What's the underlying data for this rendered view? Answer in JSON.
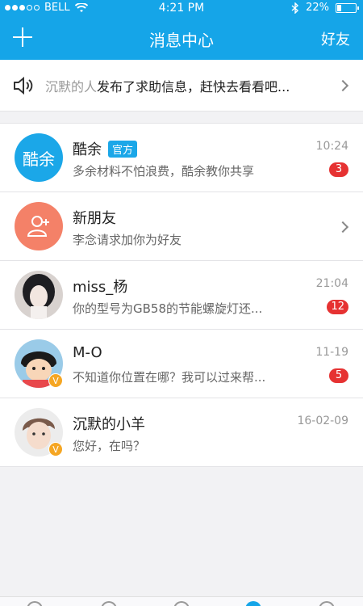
{
  "status_bar": {
    "carrier": "BELL",
    "time": "4:21 PM",
    "battery": "22%",
    "battery_level": 0.22
  },
  "nav": {
    "title": "消息中心",
    "right_label": "好友"
  },
  "notice": {
    "name": "沉默的人",
    "text": "发布了求助信息，赶快去看看吧..."
  },
  "rows": [
    {
      "title": "酷余",
      "tag": "官方",
      "avatar_text": "酷余",
      "subtitle": "多余材料不怕浪费，酷余教你共享",
      "time": "10:24",
      "count": "3"
    },
    {
      "title": "新朋友",
      "subtitle": "李念请求加你为好友"
    },
    {
      "title": "miss_杨",
      "subtitle": "你的型号为GB58的节能螺旋灯还...",
      "time": "21:04",
      "count": "12"
    },
    {
      "title": "M-O",
      "subtitle": "不知道你位置在哪？我可以过来帮...",
      "time": "11-19",
      "count": "5",
      "vip": "V"
    },
    {
      "title": "沉默的小羊",
      "subtitle": "您好，在吗？",
      "time": "16-02-09",
      "vip": "V"
    }
  ],
  "colors": {
    "brand": "#15a5e8",
    "badge_red": "#e63232",
    "new_friend": "#f48168"
  }
}
